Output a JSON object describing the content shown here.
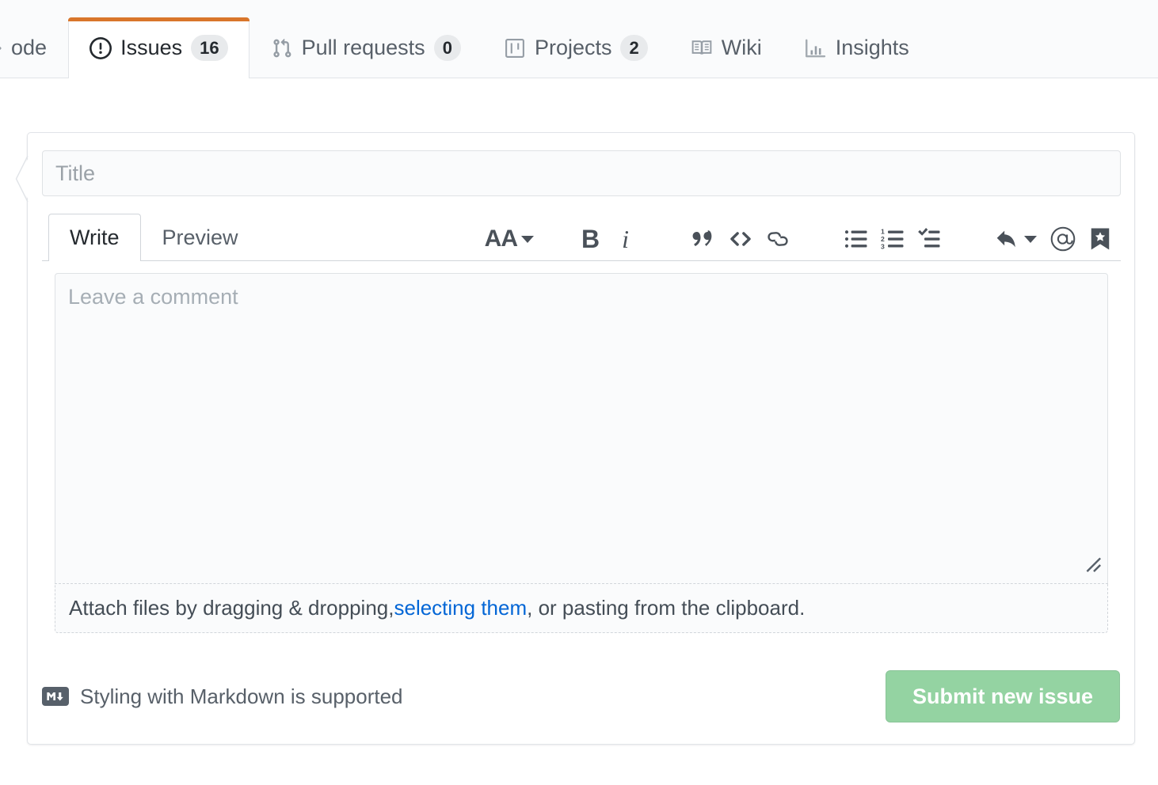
{
  "nav": {
    "items": [
      {
        "label": "ode",
        "icon": "code-icon",
        "count": null,
        "selected": false,
        "name": "nav-item-code"
      },
      {
        "label": "Issues",
        "icon": "issue-opened-icon",
        "count": "16",
        "selected": true,
        "name": "nav-item-issues"
      },
      {
        "label": "Pull requests",
        "icon": "git-pull-request-icon",
        "count": "0",
        "selected": false,
        "name": "nav-item-pull-requests"
      },
      {
        "label": "Projects",
        "icon": "project-board-icon",
        "count": "2",
        "selected": false,
        "name": "nav-item-projects"
      },
      {
        "label": "Wiki",
        "icon": "book-icon",
        "count": null,
        "selected": false,
        "name": "nav-item-wiki"
      },
      {
        "label": "Insights",
        "icon": "graph-icon",
        "count": null,
        "selected": false,
        "name": "nav-item-insights"
      }
    ],
    "accent_color": "#d9762b"
  },
  "form": {
    "title_field": {
      "value": "",
      "placeholder": "Title"
    },
    "tabs": [
      {
        "label": "Write",
        "selected": true
      },
      {
        "label": "Preview",
        "selected": false
      }
    ],
    "toolbar": [
      {
        "icon": "heading-icon",
        "label": "AA",
        "has_caret": true
      },
      {
        "icon": "bold-icon",
        "label": "B",
        "has_caret": false
      },
      {
        "icon": "italic-icon",
        "label": "i",
        "has_caret": false
      },
      {
        "icon": "quote-icon",
        "label": "",
        "has_caret": false
      },
      {
        "icon": "code-icon",
        "label": "",
        "has_caret": false
      },
      {
        "icon": "link-icon",
        "label": "",
        "has_caret": false
      },
      {
        "icon": "unordered-list-icon",
        "label": "",
        "has_caret": false
      },
      {
        "icon": "ordered-list-icon",
        "label": "",
        "has_caret": false
      },
      {
        "icon": "task-list-icon",
        "label": "",
        "has_caret": false
      },
      {
        "icon": "reply-icon",
        "label": "",
        "has_caret": true
      },
      {
        "icon": "mention-icon",
        "label": "",
        "has_caret": false
      },
      {
        "icon": "saved-reply-icon",
        "label": "",
        "has_caret": false
      }
    ],
    "comment_field": {
      "value": "",
      "placeholder": "Leave a comment"
    },
    "dropzone": {
      "text_before": "Attach files by dragging & dropping, ",
      "link_text": "selecting them",
      "text_after": ", or pasting from the clipboard."
    },
    "markdown_note": {
      "badge": "M",
      "text": "Styling with Markdown is supported"
    },
    "submit_button": {
      "label": "Submit new issue",
      "color": "#94d3a2",
      "disabled": true
    }
  }
}
